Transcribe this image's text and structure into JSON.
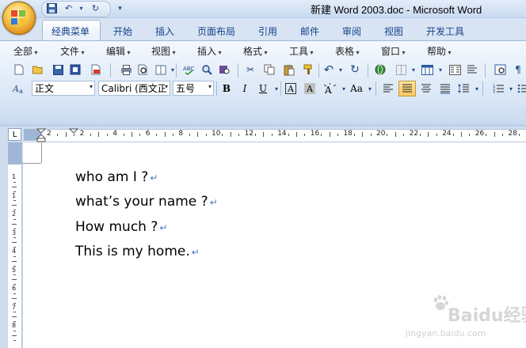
{
  "window": {
    "title": "新建 Word 2003.doc - Microsoft Word"
  },
  "tabs": [
    "经典菜单",
    "开始",
    "插入",
    "页面布局",
    "引用",
    "邮件",
    "审阅",
    "视图",
    "开发工具"
  ],
  "classic_menu": [
    "全部",
    "文件",
    "编辑",
    "视图",
    "插入",
    "格式",
    "工具",
    "表格",
    "窗口",
    "帮助"
  ],
  "format_bar": {
    "style": "正文",
    "font": "Calibri (西文正",
    "size": "五号",
    "bold": "B",
    "italic": "I",
    "underline": "U",
    "char_border": "A",
    "char_shading": "A",
    "change_case": "Aa"
  },
  "ruler": {
    "corner": "L",
    "h_ticks": [
      "2",
      "2",
      "4",
      "6",
      "8",
      "10",
      "12",
      "14",
      "16",
      "18",
      "20",
      "22",
      "24",
      "26",
      "28"
    ],
    "v_ticks": [
      "1",
      "1",
      "2",
      "3",
      "4",
      "5",
      "6",
      "7",
      "8"
    ]
  },
  "document": {
    "lines": [
      "who am I ?",
      "what’s your name ?",
      "How much ?",
      "This is my home."
    ],
    "para_mark": "↵"
  },
  "watermark": {
    "brand": "Baidu经验",
    "url": "jingyan.baidu.com"
  }
}
